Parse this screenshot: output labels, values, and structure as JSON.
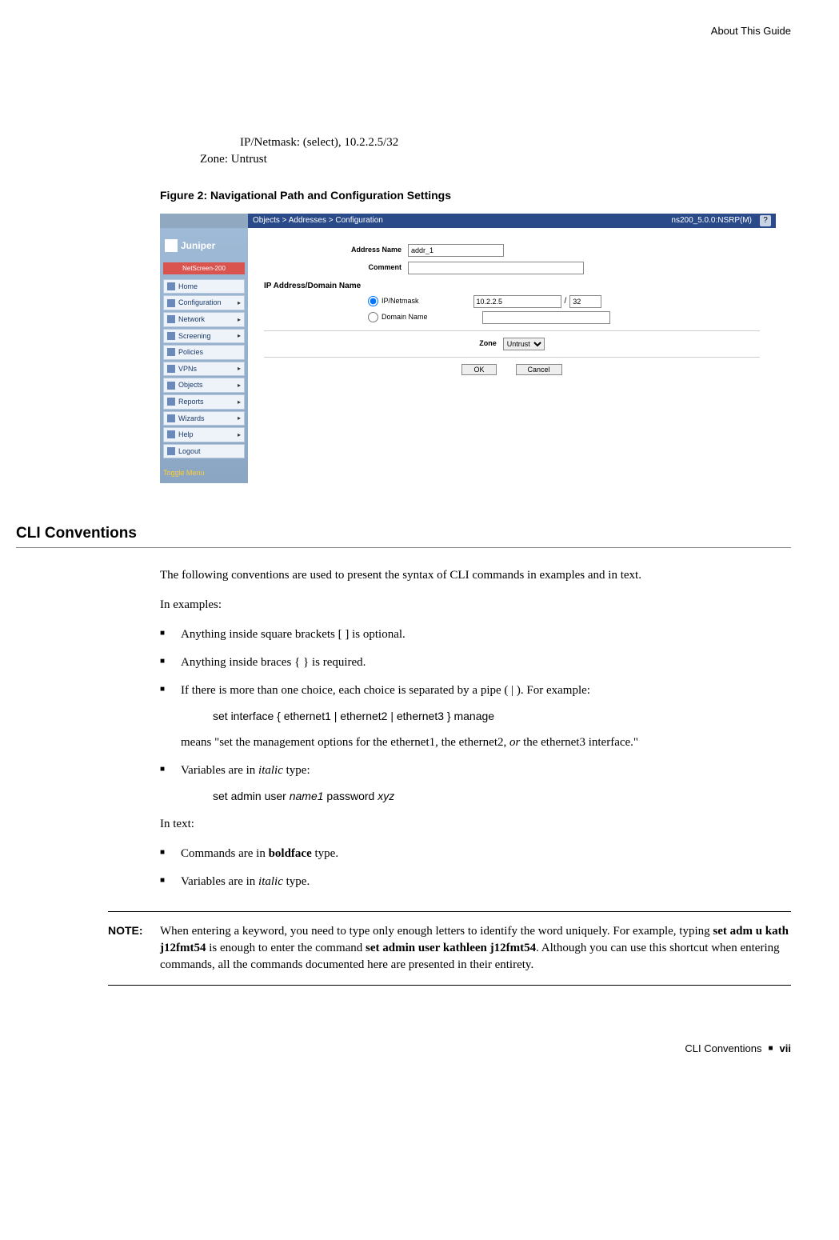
{
  "header": {
    "section": "About This Guide"
  },
  "intro_lines": {
    "ip": "IP/Netmask: (select), 10.2.2.5/32",
    "zone": "Zone: Untrust"
  },
  "figure": {
    "caption": "Figure 2:  Navigational Path and Configuration Settings",
    "breadcrumb": "Objects > Addresses > Configuration",
    "device": "ns200_5.0.0:NSRP(M)",
    "logo": "Juniper",
    "product": "NetScreen-200",
    "menu": [
      {
        "label": "Home",
        "arrow": false
      },
      {
        "label": "Configuration",
        "arrow": true
      },
      {
        "label": "Network",
        "arrow": true
      },
      {
        "label": "Screening",
        "arrow": true
      },
      {
        "label": "Policies",
        "arrow": false
      },
      {
        "label": "VPNs",
        "arrow": true
      },
      {
        "label": "Objects",
        "arrow": true
      },
      {
        "label": "Reports",
        "arrow": true
      },
      {
        "label": "Wizards",
        "arrow": true
      },
      {
        "label": "Help",
        "arrow": true
      },
      {
        "label": "Logout",
        "arrow": false
      }
    ],
    "toggle": "Toggle Menu",
    "form": {
      "address_name_label": "Address Name",
      "address_name_value": "addr_1",
      "comment_label": "Comment",
      "comment_value": "",
      "section": "IP Address/Domain Name",
      "ip_label": "IP/Netmask",
      "ip_value": "10.2.2.5",
      "mask_value": "32",
      "domain_label": "Domain Name",
      "zone_label": "Zone",
      "zone_value": "Untrust",
      "ok": "OK",
      "cancel": "Cancel"
    }
  },
  "section_title": "CLI Conventions",
  "para1": "The following conventions are used to present the syntax of CLI commands in examples and in text.",
  "para2": "In examples:",
  "bullets1": {
    "b1": "Anything inside square brackets [ ] is optional.",
    "b2": "Anything inside braces { } is required.",
    "b3a": "If there is more than one choice, each choice is separated by a pipe ( | ). For example:",
    "b3_cmd": "set interface { ethernet1 | ethernet2 | ethernet3 } manage",
    "b3b_pre": "means \"set the management options for the ethernet1, the ethernet2, ",
    "b3b_or": "or",
    "b3b_post": " the ethernet3 interface.\"",
    "b4_pre": "Variables are in ",
    "b4_it": "italic",
    "b4_post": " type:",
    "b4_cmd_pre": "set admin user ",
    "b4_cmd_v1": "name1",
    "b4_cmd_mid": " password ",
    "b4_cmd_v2": "xyz"
  },
  "para3": "In text:",
  "bullets2": {
    "b1_pre": "Commands are in ",
    "b1_bold": "boldface",
    "b1_post": " type.",
    "b2_pre": "Variables are in ",
    "b2_it": "italic",
    "b2_post": " type."
  },
  "note": {
    "label": "NOTE:",
    "t1": "When entering a keyword, you need to type only enough letters to identify the word uniquely. For example, typing ",
    "b1": "set adm u kath j12fmt54",
    "t2": " is enough to enter the command ",
    "b2": "set admin user kathleen j12fmt54",
    "t3": ". Although you can use this shortcut when entering commands, all the commands documented here are presented in their entirety."
  },
  "footer": {
    "text": "CLI Conventions",
    "page": "vii"
  }
}
